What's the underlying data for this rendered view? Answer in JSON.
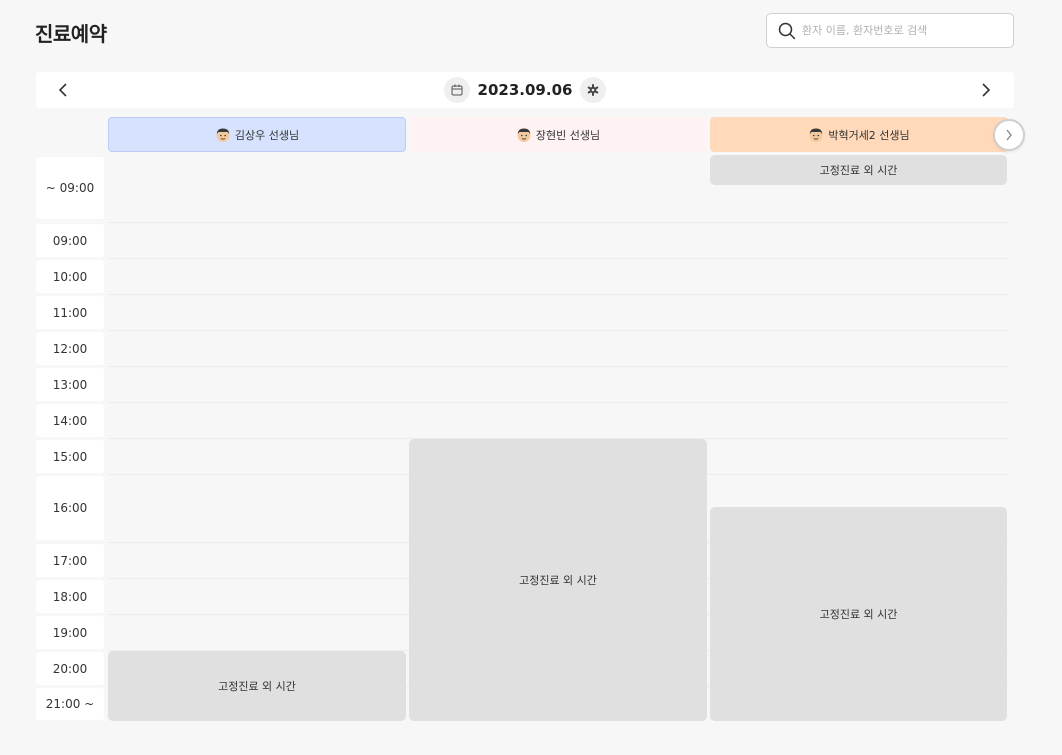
{
  "header": {
    "title": "진료예약",
    "search_placeholder": "환자 이름, 환자번호로 검색"
  },
  "date_nav": {
    "date": "2023.09.06"
  },
  "doctors": [
    {
      "label": "김상우 선생님",
      "color": "#d7e3fe"
    },
    {
      "label": "장현빈 선생님",
      "color": "#fff2f2"
    },
    {
      "label": "박혁거세2 선생님",
      "color": "#ffd9ba"
    }
  ],
  "time_slots": [
    "~ 09:00",
    "09:00",
    "10:00",
    "11:00",
    "12:00",
    "13:00",
    "14:00",
    "15:00",
    "16:00",
    "17:00",
    "18:00",
    "19:00",
    "20:00",
    "21:00 ~"
  ],
  "blocked_slots": [
    {
      "label": "고정진료 외 시간",
      "doctor": "박혁거세2 선생님",
      "start": "~ 09:00",
      "end": "~ 09:00"
    },
    {
      "label": "고정진료 외 시간",
      "doctor": "장현빈 선생님",
      "start": "15:00",
      "end": "21:00 ~"
    },
    {
      "label": "고정진료 외 시간",
      "doctor": "박혁거세2 선생님",
      "start": "16:00",
      "end": "21:00 ~"
    },
    {
      "label": "고정진료 외 시간",
      "doctor": "김상우 선생님",
      "start": "20:00",
      "end": "21:00 ~"
    }
  ],
  "colors": {
    "background": "#f7f7f7",
    "blocked": "#e0e0e0",
    "selected_doctor": "#d7e3fe"
  }
}
